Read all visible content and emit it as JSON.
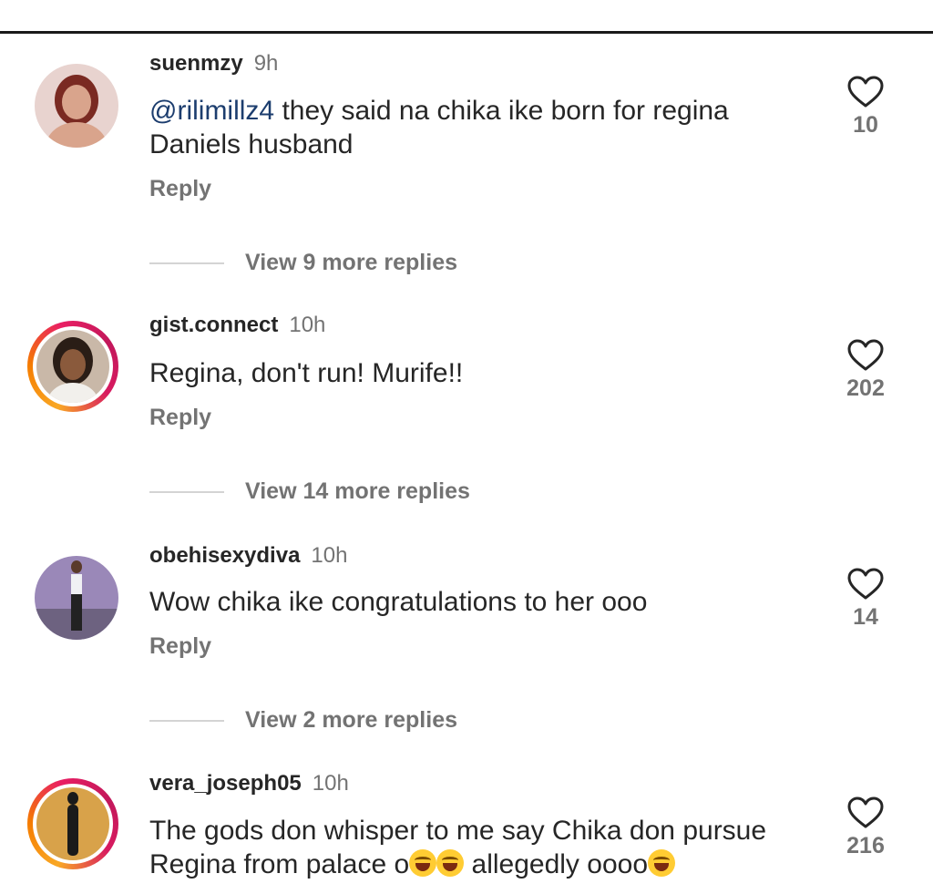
{
  "comments": [
    {
      "username": "suenmzy",
      "time": "9h",
      "mention": "@rilimillz4",
      "text": " they said na chika ike born for regina Daniels husband",
      "reply": "Reply",
      "likes": "10",
      "view_more": "View 9 more replies"
    },
    {
      "username": "gist.connect",
      "time": "10h",
      "text": "Regina, don't run! Murife!!",
      "reply": "Reply",
      "likes": "202",
      "view_more": "View 14 more replies"
    },
    {
      "username": "obehisexydiva",
      "time": "10h",
      "text": "Wow chika ike congratulations to her ooo",
      "reply": "Reply",
      "likes": "14",
      "view_more": "View 2 more replies"
    },
    {
      "username": "vera_joseph05",
      "time": "10h",
      "text_line1": "The gods don whisper to me say Chika don pursue",
      "text_line2a": "Regina from palace o",
      "text_line2b": " allegedly oooo",
      "likes": "216"
    }
  ],
  "icons": {
    "like": "heart-outline-icon",
    "laugh": "face-with-tears-of-joy-emoji"
  },
  "colors": {
    "text": "#262626",
    "muted": "#737373",
    "mention": "#1c3d6e",
    "story_ring": "#e91e63"
  }
}
